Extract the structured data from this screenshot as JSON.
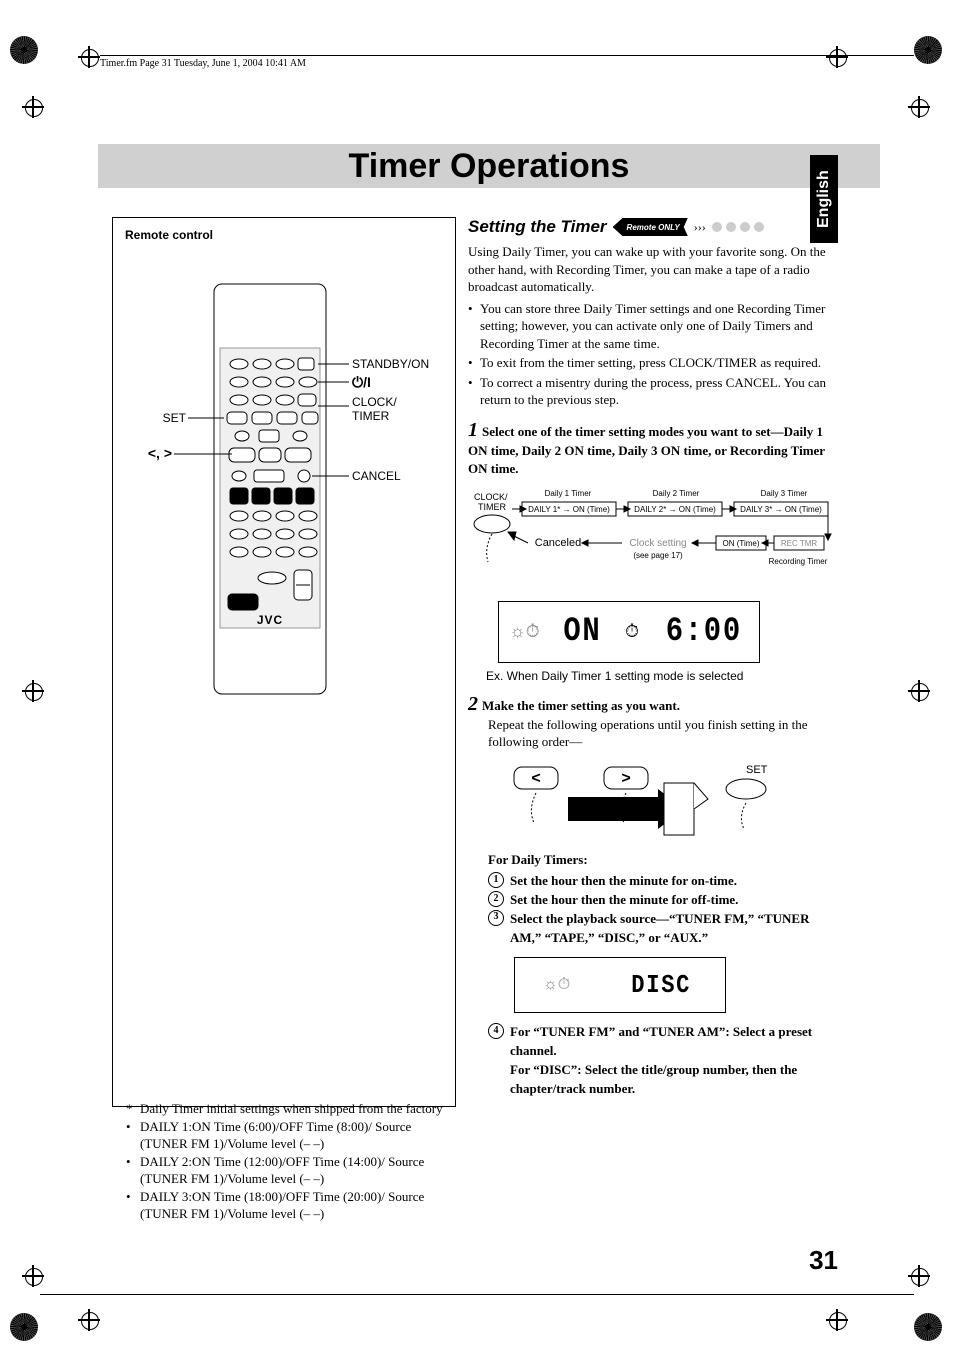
{
  "header": {
    "crop_info": "Timer.fm  Page 31  Tuesday, June 1, 2004  10:41 AM"
  },
  "title": "Timer Operations",
  "lang_tab": "English",
  "page_number": "31",
  "remote": {
    "box_title": "Remote control",
    "labels": {
      "standby": "STANDBY/ON",
      "clock_timer": "CLOCK/\nTIMER",
      "set": "SET",
      "arrows": "<, >",
      "cancel": "CANCEL",
      "brand": "JVC"
    }
  },
  "factory": {
    "intro": "Daily Timer initial settings when shipped from the factory",
    "items": [
      "DAILY 1:ON Time (6:00)/OFF Time (8:00)/ Source (TUNER FM 1)/Volume level (– –)",
      "DAILY 2:ON Time (12:00)/OFF Time (14:00)/ Source (TUNER FM 1)/Volume level (– –)",
      "DAILY 3:ON Time (18:00)/OFF Time (20:00)/ Source (TUNER FM 1)/Volume level (– –)"
    ]
  },
  "section": {
    "heading": "Setting the Timer",
    "badge": "Remote ONLY",
    "intro": "Using Daily Timer, you can wake up with your favorite song. On the other hand, with Recording Timer, you can make a tape of a radio broadcast automatically.",
    "bullets": [
      "You can store three Daily Timer settings and one Recording Timer setting; however, you can activate only one of Daily Timers and Recording Timer at the same time.",
      "To exit from the timer setting, press CLOCK/TIMER as required.",
      "To correct a misentry during the process, press CANCEL. You can return to the previous step."
    ],
    "step1": "Select one of the timer setting modes you want to set—Daily 1 ON time, Daily 2 ON time, Daily 3 ON time, or Recording Timer ON time.",
    "fig1": {
      "clock_timer": "CLOCK/\nTIMER",
      "d1": "Daily 1 Timer",
      "d2": "Daily 2 Timer",
      "d3": "Daily 3 Timer",
      "daily1_box": "DAILY 1* → ON (Time)",
      "daily2_box": "DAILY 2* → ON (Time)",
      "daily3_box": "DAILY 3* → ON (Time)",
      "canceled": "Canceled",
      "clock_setting": "Clock setting",
      "see_page": "(see page 17)",
      "on_time": "ON (Time)",
      "rec_tmr": "REC TMR",
      "rec_label": "Recording Timer",
      "lcd_on": "ON",
      "lcd_time": "6:00"
    },
    "fig1_cap": "Ex. When Daily Timer 1 setting mode is selected",
    "step2": "Make the timer setting as you want.",
    "step2_sub": "Repeat the following operations until you finish setting in the following order—",
    "fig2_set": "SET",
    "daily_title": "For Daily Timers:",
    "numbered": [
      "Set the hour then the minute for on-time.",
      "Set the hour then the minute for off-time.",
      "Select the playback source—“TUNER FM,” “TUNER AM,” “TAPE,” “DISC,” or “AUX.”"
    ],
    "lcd2": "DISC",
    "num4": "For “TUNER FM” and “TUNER AM”: Select a preset channel.\nFor “DISC”: Select the title/group number, then the chapter/track number."
  }
}
